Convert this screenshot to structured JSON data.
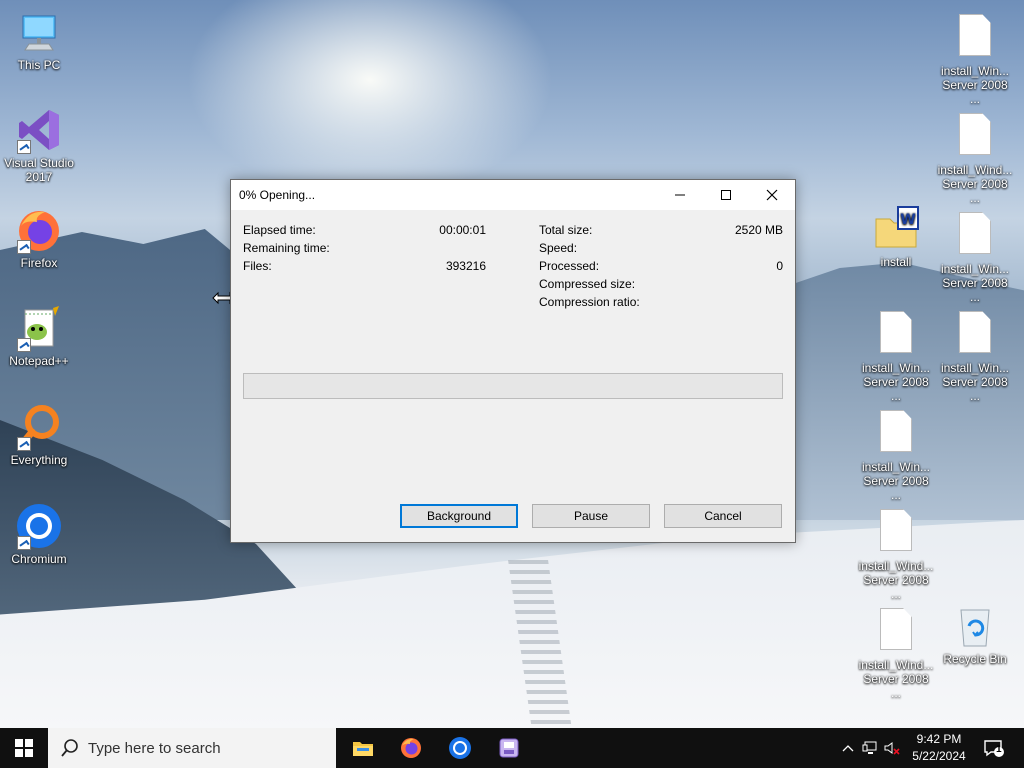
{
  "desktop": {
    "left_icons": [
      {
        "label": "This PC",
        "icon": "this-pc-icon"
      },
      {
        "label": "Visual Studio 2017",
        "icon": "visual-studio-icon"
      },
      {
        "label": "Firefox",
        "icon": "firefox-icon"
      },
      {
        "label": "Notepad++",
        "icon": "notepadpp-icon"
      },
      {
        "label": "Everything",
        "icon": "everything-icon"
      },
      {
        "label": "Chromium",
        "icon": "chromium-icon"
      }
    ],
    "right_icons": [
      {
        "label": "install_Win... Server 2008 ...",
        "icon": "file-icon"
      },
      {
        "label": "install_Wind... Server 2008 ...",
        "icon": "file-icon"
      },
      {
        "label": "install",
        "icon": "folder-word-icon"
      },
      {
        "label": "install_Win... Server 2008 ...",
        "icon": "file-icon"
      },
      {
        "label": "install_Win... Server 2008 ...",
        "icon": "file-icon"
      },
      {
        "label": "install_Win... Server 2008 ...",
        "icon": "file-icon"
      },
      {
        "label": "install_Win... Server 2008 ...",
        "icon": "file-icon"
      },
      {
        "label": "install_Wind... Server 2008 ...",
        "icon": "file-icon"
      },
      {
        "label": "install_Wind... Server 2008 ...",
        "icon": "file-icon"
      },
      {
        "label": "Recycle Bin",
        "icon": "recycle-bin-icon"
      }
    ]
  },
  "dialog": {
    "title": "0% Opening...",
    "progress": 0,
    "left_fields": [
      {
        "label": "Elapsed time:",
        "value": "00:00:01"
      },
      {
        "label": "Remaining time:",
        "value": ""
      },
      {
        "label": "Files:",
        "value": "393216"
      }
    ],
    "right_fields": [
      {
        "label": "Total size:",
        "value": "2520 MB"
      },
      {
        "label": "Speed:",
        "value": ""
      },
      {
        "label": "Processed:",
        "value": "0"
      },
      {
        "label": "Compressed size:",
        "value": ""
      },
      {
        "label": "Compression ratio:",
        "value": ""
      }
    ],
    "buttons": {
      "background": "Background",
      "pause": "Pause",
      "cancel": "Cancel"
    }
  },
  "taskbar": {
    "search_placeholder": "Type here to search",
    "apps": [
      "file-explorer-icon",
      "firefox-icon",
      "chromium-icon",
      "app-icon"
    ],
    "clock": {
      "time": "9:42 PM",
      "date": "5/22/2024"
    },
    "notification_count": "1"
  }
}
